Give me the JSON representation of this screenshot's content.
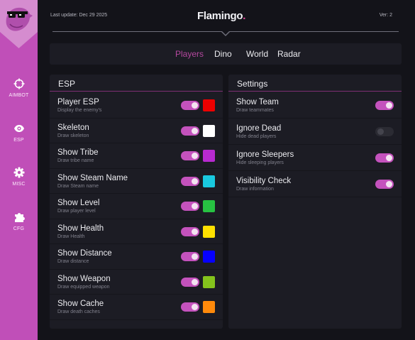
{
  "header": {
    "last_update": "Last update: Dec 29 2025",
    "brand": "Flamingo",
    "brand_dot": ".",
    "version": "Ver: 2"
  },
  "colors": {
    "sidebar": "#c04fb8",
    "accent": "#c452bd",
    "active_tab": "#b5489f",
    "background": "#131319",
    "panel": "#1c1c24"
  },
  "sidebar": {
    "logo_icon": "flamingo-sunglasses-icon",
    "items": [
      {
        "label": "AIMBOT",
        "icon": "crosshair-icon"
      },
      {
        "label": "ESP",
        "icon": "eye-icon"
      },
      {
        "label": "MISC",
        "icon": "gear-icon"
      },
      {
        "label": "CFG",
        "icon": "puzzle-icon"
      }
    ]
  },
  "tabs": [
    {
      "label": "Players",
      "active": true
    },
    {
      "label": "Dino",
      "active": false
    },
    {
      "label": "World",
      "active": false
    },
    {
      "label": "Radar",
      "active": false
    }
  ],
  "esp_panel": {
    "title": "ESP",
    "rows": [
      {
        "name": "Player ESP",
        "desc": "Display the enemy's",
        "enabled": true,
        "color": "#ee0000"
      },
      {
        "name": "Skeleton",
        "desc": "Draw skeleton",
        "enabled": true,
        "color": "#ffffff"
      },
      {
        "name": "Show Tribe",
        "desc": "Draw tribe name",
        "enabled": true,
        "color": "#b72ad0"
      },
      {
        "name": "Show Steam Name",
        "desc": "Draw Steam name",
        "enabled": true,
        "color": "#19c9df"
      },
      {
        "name": "Show Level",
        "desc": "Draw player level",
        "enabled": true,
        "color": "#27c242"
      },
      {
        "name": "Show Health",
        "desc": "Draw Health",
        "enabled": true,
        "color": "#ffe100"
      },
      {
        "name": "Show Distance",
        "desc": "Draw distance",
        "enabled": true,
        "color": "#0600ff"
      },
      {
        "name": "Show Weapon",
        "desc": "Draw equipped weapon",
        "enabled": true,
        "color": "#84c31c"
      },
      {
        "name": "Show Cache",
        "desc": "Draw death caches",
        "enabled": true,
        "color": "#ff8a0b"
      }
    ]
  },
  "settings_panel": {
    "title": "Settings",
    "rows": [
      {
        "name": "Show Team",
        "desc": "Draw teammates",
        "enabled": true
      },
      {
        "name": "Ignore Dead",
        "desc": "Hide dead players",
        "enabled": false
      },
      {
        "name": "Ignore Sleepers",
        "desc": "Hide sleeping players",
        "enabled": true
      },
      {
        "name": "Visibility Check",
        "desc": "Draw information",
        "enabled": true
      }
    ]
  }
}
